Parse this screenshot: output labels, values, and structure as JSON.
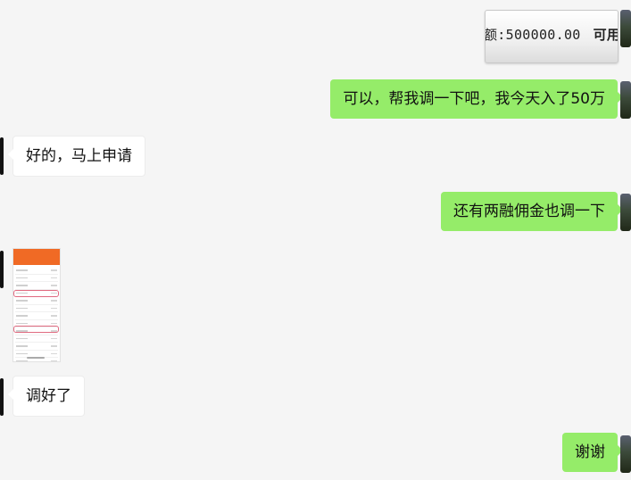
{
  "messages": [
    {
      "id": "m1",
      "side": "right",
      "type": "image",
      "image_text": {
        "amount_fragment": "额:500000.00",
        "avail_fragment": "可用:"
      }
    },
    {
      "id": "m2",
      "side": "right",
      "type": "text",
      "text": "可以，帮我调一下吧，我今天入了50万"
    },
    {
      "id": "m3",
      "side": "left",
      "type": "text",
      "text": "好的，马上申请"
    },
    {
      "id": "m4",
      "side": "right",
      "type": "text",
      "text": "还有两融佣金也调一下"
    },
    {
      "id": "m5",
      "side": "left",
      "type": "image",
      "image_desc": "phone-screenshot"
    },
    {
      "id": "m6",
      "side": "left",
      "type": "text",
      "text": "调好了"
    },
    {
      "id": "m7",
      "side": "right",
      "type": "text",
      "text": "谢谢"
    }
  ],
  "colors": {
    "background": "#f5f5f5",
    "sent_bubble": "#95ec69",
    "received_bubble": "#ffffff",
    "header_orange": "#f06a25"
  }
}
